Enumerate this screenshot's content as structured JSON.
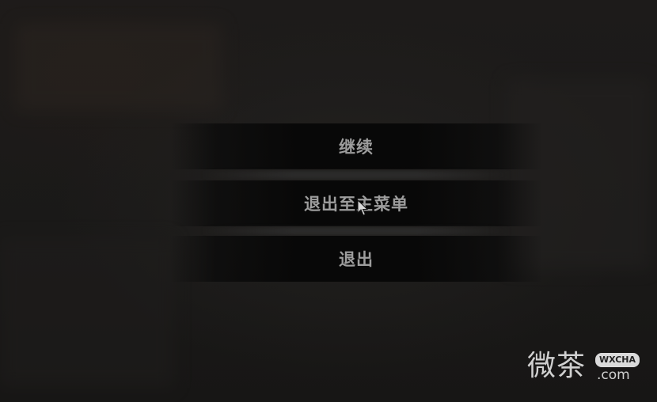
{
  "pause_menu": {
    "items": [
      {
        "label": "继续"
      },
      {
        "label": "退出至主菜单"
      },
      {
        "label": "退出"
      }
    ]
  },
  "watermark": {
    "main_text": "微茶",
    "badge_text": "WXCHA",
    "domain_text": ".com"
  }
}
